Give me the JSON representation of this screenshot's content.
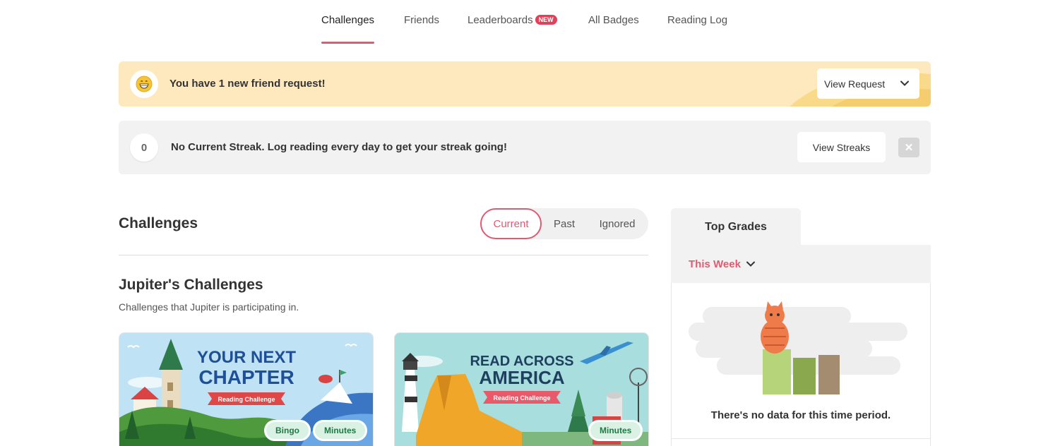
{
  "nav": {
    "tabs": [
      {
        "label": "Challenges",
        "active": true
      },
      {
        "label": "Friends"
      },
      {
        "label": "Leaderboards",
        "badge": "NEW"
      },
      {
        "label": "All Badges"
      },
      {
        "label": "Reading Log"
      }
    ]
  },
  "friend_banner": {
    "text": "You have 1 new friend request!",
    "button": "View Request",
    "icon": "grinning-face-emoji"
  },
  "streak_banner": {
    "count": "0",
    "text": "No Current Streak. Log reading every day to get your streak going!",
    "button": "View Streaks",
    "close": "✕"
  },
  "challenges": {
    "title": "Challenges",
    "filters": [
      {
        "label": "Current",
        "active": true
      },
      {
        "label": "Past"
      },
      {
        "label": "Ignored"
      }
    ],
    "group_title": "Jupiter's Challenges",
    "group_desc": "Challenges that Jupiter is participating in.",
    "cards": [
      {
        "title_line1": "YOUR NEXT",
        "title_line2": "CHAPTER",
        "ribbon": "Reading Challenge",
        "tags": [
          "Bingo",
          "Minutes"
        ]
      },
      {
        "title_line1": "READ ACROSS",
        "title_line2": "AMERICA",
        "ribbon": "Reading Challenge",
        "tags": [
          "Minutes"
        ]
      }
    ]
  },
  "top_grades": {
    "title": "Top Grades",
    "period": "This Week",
    "empty": "There's no data for this time period."
  },
  "colors": {
    "accent": "#e05a72",
    "banner": "#fde9bd",
    "pill_bg": "#d9f2e3",
    "pill_text": "#1e7a45"
  }
}
